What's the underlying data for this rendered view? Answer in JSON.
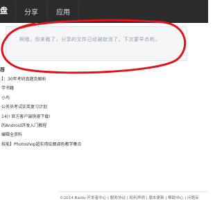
{
  "header": {
    "brand": "盘",
    "nav": [
      {
        "label": "分享"
      },
      {
        "label": "应用"
      }
    ]
  },
  "notice": {
    "message": "啊哦，你来晚了，分享的文件已经被取消了，下次要早点哟。"
  },
  "section": {
    "title": "荐"
  },
  "list": [
    {
      "text": "】：30年考研真题及解析"
    },
    {
      "text": "学书籍"
    },
    {
      "text": "小鸟"
    },
    {
      "text": "公务员考试实英复习计划"
    },
    {
      "text": "14)! 官方客户端快速下载!"
    },
    {
      "text": "的Android开发入门教程"
    },
    {
      "text": "编辑全资料"
    },
    {
      "text": "技能】Photoshop超实用绘图调色教学集合"
    }
  ],
  "footer": {
    "text": "©2014 Baidu 开发者中心 | 服务协议 | 权利声明 | 版本更新 | 帮助中心 | 问题反"
  }
}
